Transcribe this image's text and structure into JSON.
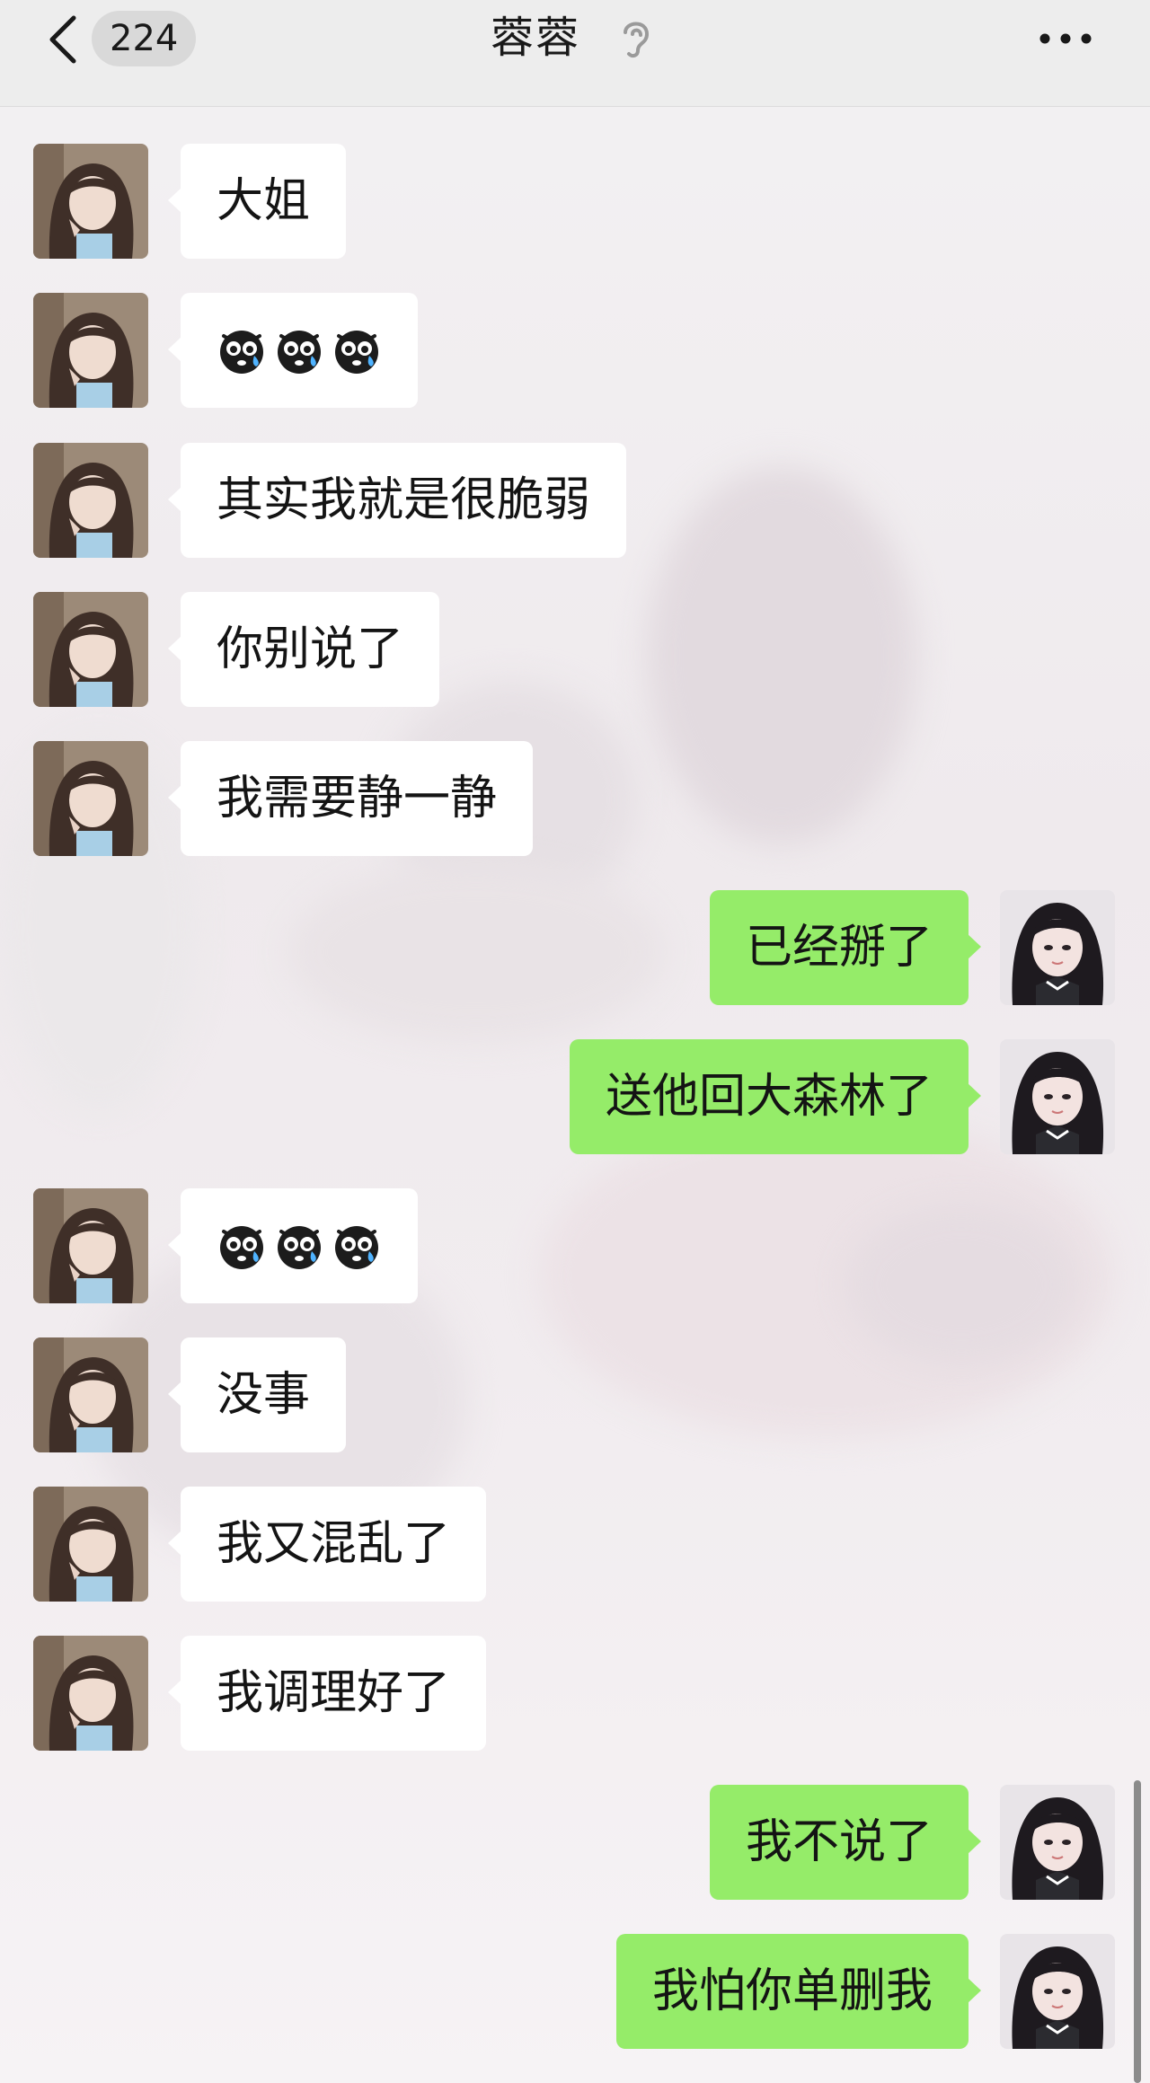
{
  "header": {
    "back_icon": "chevron-left-icon",
    "unread_count": "224",
    "title": "蓉蓉",
    "earpiece_icon": "ear-icon",
    "more_icon": "more-dots-icon"
  },
  "colors": {
    "incoming_bubble": "#ffffff",
    "outgoing_bubble": "#95ec69",
    "header_bg": "#ededed",
    "text": "#141414"
  },
  "messages": [
    {
      "side": "in",
      "text": "大姐"
    },
    {
      "side": "in",
      "text": "",
      "emoji": [
        "crying-face-emoji",
        "crying-face-emoji",
        "crying-face-emoji"
      ]
    },
    {
      "side": "in",
      "text": "其实我就是很脆弱"
    },
    {
      "side": "in",
      "text": "你别说了"
    },
    {
      "side": "in",
      "text": "我需要静一静"
    },
    {
      "side": "out",
      "text": "已经掰了"
    },
    {
      "side": "out",
      "text": "送他回大森林了"
    },
    {
      "side": "in",
      "text": "",
      "emoji": [
        "crying-face-emoji",
        "crying-face-emoji",
        "crying-face-emoji"
      ]
    },
    {
      "side": "in",
      "text": "没事"
    },
    {
      "side": "in",
      "text": "我又混乱了"
    },
    {
      "side": "in",
      "text": "我调理好了"
    },
    {
      "side": "out",
      "text": "我不说了"
    },
    {
      "side": "out",
      "text": "我怕你单删我"
    }
  ]
}
